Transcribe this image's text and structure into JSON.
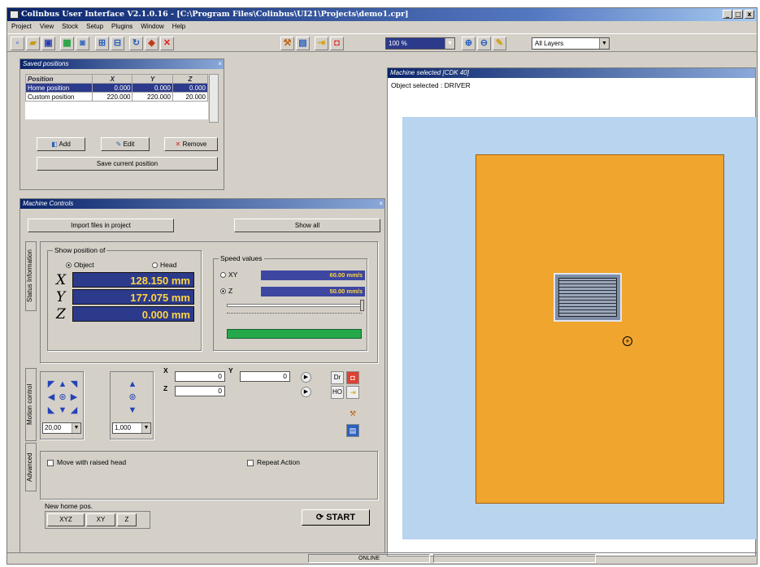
{
  "window": {
    "title": "Colinbus User Interface V2.1.0.16 - [C:\\Program Files\\Colinbus\\UI21\\Projects\\demo1.cpr]",
    "controls": [
      "_",
      "□",
      "x"
    ]
  },
  "menu": [
    "Project",
    "View",
    "Stock",
    "Setup",
    "Plugins",
    "Window",
    "Help"
  ],
  "toolbar": {
    "zoom": "100 %",
    "layers": "All Layers"
  },
  "saved_positions": {
    "title": "Saved positions",
    "columns": [
      "Position",
      "X",
      "Y",
      "Z"
    ],
    "rows": [
      {
        "name": "Home position",
        "x": "0.000",
        "y": "0.000",
        "z": "0.000"
      },
      {
        "name": "Custom position",
        "x": "220.000",
        "y": "220.000",
        "z": "20.000"
      }
    ],
    "add": "Add",
    "edit": "Edit",
    "remove": "Remove",
    "save_current": "Save current position"
  },
  "machine_controls": {
    "title": "Machine Controls",
    "import_files": "Import files in project",
    "show_all": "Show all",
    "tabs": [
      "Status Information",
      "Motion control",
      "Advanced"
    ],
    "show_position_of": "Show position of",
    "object_label": "Object",
    "head_label": "Head",
    "axis_x": "X",
    "axis_y": "Y",
    "axis_z": "Z",
    "pos_x": "128.150 mm",
    "pos_y": "177.075 mm",
    "pos_z": "0.000 mm",
    "speed_values": "Speed values",
    "speed_xy_label": "XY",
    "speed_z_label": "Z",
    "speed_xy": "60.00 mm/s",
    "speed_z": "50.00 mm/s",
    "step_value": "20,00",
    "z_step_value": "1,000",
    "coord_x_label": "X",
    "coord_y_label": "Y",
    "coord_z_label": "Z",
    "coord_x": "0",
    "coord_y": "0",
    "coord_z": "0",
    "btn_dr": "Dr",
    "btn_ho": "HO",
    "move_raised": "Move with raised head",
    "repeat_action": "Repeat Action",
    "new_home": "New home pos.",
    "home_xyz": "XYZ",
    "home_xy": "XY",
    "home_z": "Z",
    "start": "START"
  },
  "machine_view": {
    "title": "Machine selected [CDK 40]",
    "object_selected": "Object selected : DRIVER"
  },
  "statusbar": {
    "mode": "ONLINE"
  },
  "colors": {
    "table": "#f0a52e",
    "workspace": "#b8d4ee",
    "value_box": "#2c3a8c",
    "value_text": "#ffd640"
  }
}
